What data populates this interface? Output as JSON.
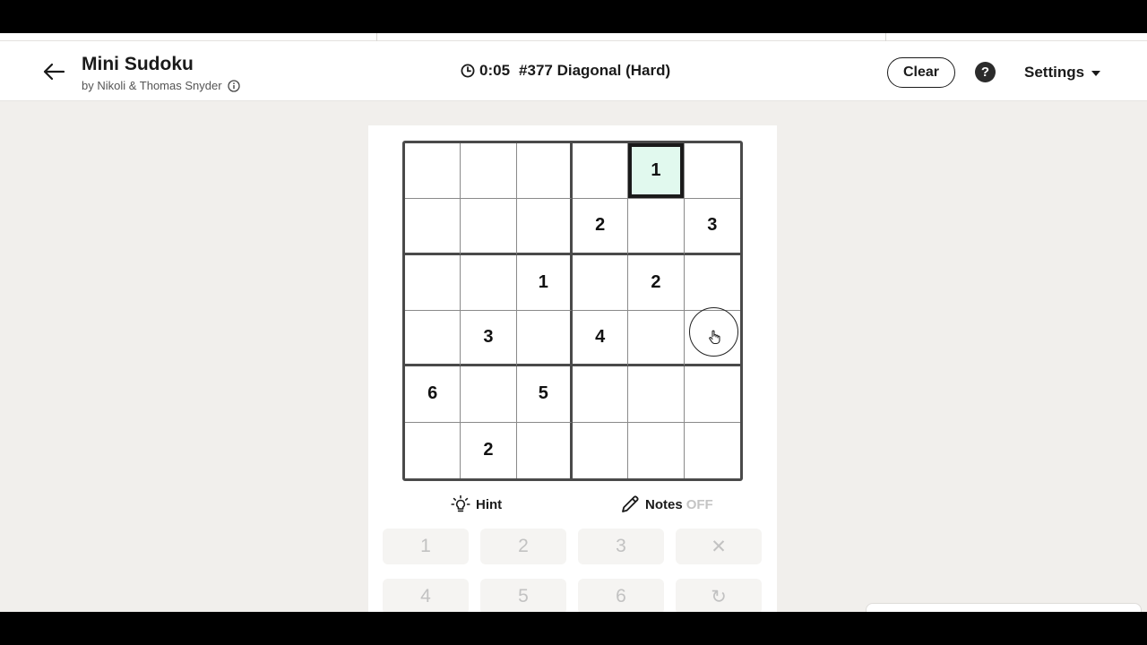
{
  "header": {
    "title": "Mini Sudoku",
    "byline": "by Nikoli & Thomas Snyder",
    "timer": "0:05",
    "puzzle_label": "#377 Diagonal (Hard)",
    "clear_label": "Clear",
    "help_label": "?",
    "settings_label": "Settings"
  },
  "board": {
    "rows": [
      [
        "",
        "",
        "",
        "",
        "1",
        ""
      ],
      [
        "",
        "",
        "",
        "2",
        "",
        "3"
      ],
      [
        "",
        "",
        "1",
        "",
        "2",
        ""
      ],
      [
        "",
        "3",
        "",
        "4",
        "",
        ""
      ],
      [
        "6",
        "",
        "5",
        "",
        "",
        ""
      ],
      [
        "",
        "2",
        "",
        "",
        "",
        ""
      ]
    ],
    "selected_cell": [
      0,
      4
    ]
  },
  "tools": {
    "hint_label": "Hint",
    "notes_label": "Notes",
    "notes_state": "OFF"
  },
  "keypad": {
    "keys": [
      "1",
      "2",
      "3",
      "✕",
      "4",
      "5",
      "6",
      "↻"
    ]
  },
  "colors": {
    "page_background": "#f1efec",
    "selected_cell": "#eefcf4",
    "grid_border": "#4a4a4a"
  }
}
